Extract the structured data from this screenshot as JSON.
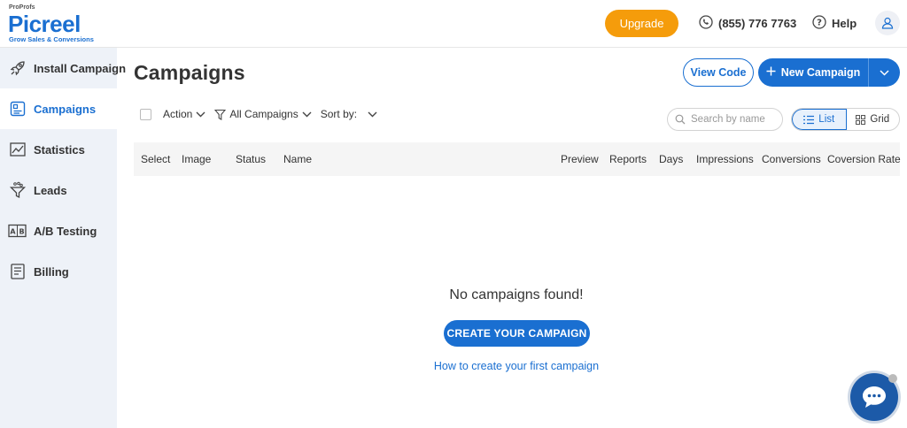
{
  "brand": {
    "top": "ProProfs",
    "name": "Picreel",
    "tagline": "Grow Sales & Conversions",
    "color": "#1a6fd1"
  },
  "header": {
    "upgrade_label": "Upgrade",
    "phone": "(855) 776 7763",
    "help_label": "Help",
    "upgrade_color": "#f59c0b"
  },
  "sidebar": {
    "items": [
      {
        "label": "Install Campaign",
        "icon": "rocket-icon"
      },
      {
        "label": "Campaigns",
        "icon": "campaigns-icon",
        "active": true
      },
      {
        "label": "Statistics",
        "icon": "chart-icon"
      },
      {
        "label": "Leads",
        "icon": "funnel-icon"
      },
      {
        "label": "A/B Testing",
        "icon": "ab-test-icon"
      },
      {
        "label": "Billing",
        "icon": "document-icon"
      }
    ]
  },
  "main": {
    "title": "Campaigns",
    "view_code_label": "View Code",
    "new_campaign_label": "New Campaign",
    "toolbar": {
      "action_label": "Action",
      "filter_label": "All Campaigns",
      "sort_label": "Sort by:"
    },
    "search_placeholder": "Search by name",
    "view_list_label": "List",
    "view_grid_label": "Grid",
    "columns": [
      "Select",
      "Image",
      "Status",
      "Name",
      "Preview",
      "Reports",
      "Days",
      "Impressions",
      "Conversions",
      "Coversion Rate"
    ],
    "empty_message": "No campaigns found!",
    "create_label": "CREATE YOUR CAMPAIGN",
    "how_link": "How to create your first campaign"
  }
}
